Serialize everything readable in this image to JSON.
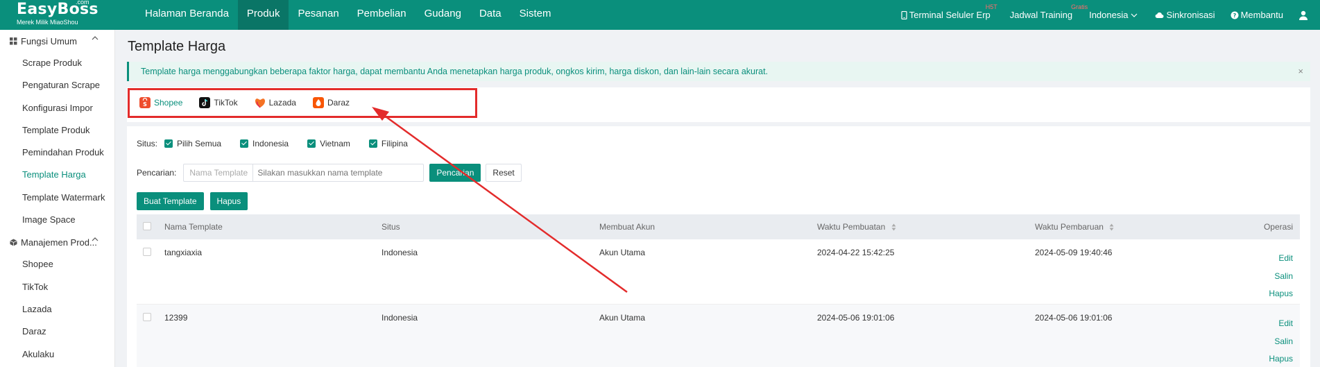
{
  "header": {
    "brand": "EasyBoss",
    "brand_suffix": ".com",
    "brand_sub": "Merek Milik MiaoShou",
    "nav": [
      "Halaman Beranda",
      "Produk",
      "Pesanan",
      "Pembelian",
      "Gudang",
      "Data",
      "Sistem"
    ],
    "active_nav": "Produk",
    "right": {
      "terminal": "Terminal Seluler Erp",
      "terminal_badge": "H5T",
      "training": "Jadwal Training",
      "training_badge": "Gratis",
      "language": "Indonesia",
      "sync": "Sinkronisasi",
      "help": "Membantu"
    }
  },
  "sidebar": {
    "group1": "Fungsi Umum",
    "group1_items": [
      "Scrape Produk",
      "Pengaturan Scrape",
      "Konfigurasi Impor",
      "Template Produk",
      "Pemindahan Produk",
      "Template Harga",
      "Template Watermark",
      "Image Space"
    ],
    "active_item": "Template Harga",
    "group2": "Manajemen Prod...",
    "group2_items": [
      "Shopee",
      "TikTok",
      "Lazada",
      "Daraz",
      "Akulaku"
    ]
  },
  "page": {
    "title": "Template Harga",
    "alert": "Template harga menggabungkan beberapa faktor harga, dapat membantu Anda menetapkan harga produk, ongkos kirim, harga diskon, dan lain-lain secara akurat.",
    "alert_close": "×",
    "platforms": [
      {
        "label": "Shopee",
        "color": "#ee4d2d",
        "active": true
      },
      {
        "label": "TikTok",
        "color": "#111111",
        "active": false
      },
      {
        "label": "Lazada",
        "color": "#f57224",
        "active": false
      },
      {
        "label": "Daraz",
        "color": "#f85606",
        "active": false
      }
    ],
    "filter": {
      "label": "Situs:",
      "options": [
        "Pilih Semua",
        "Indonesia",
        "Vietnam",
        "Filipina"
      ]
    },
    "search": {
      "label": "Pencarian:",
      "select_value": "Nama Template",
      "placeholder": "Silakan masukkan nama template",
      "search_btn": "Pencarian",
      "reset_btn": "Reset"
    },
    "actions": {
      "create": "Buat Template",
      "delete": "Hapus"
    },
    "table": {
      "columns": [
        "Nama Template",
        "Situs",
        "Membuat Akun",
        "Waktu Pembuatan",
        "Waktu Pembaruan",
        "Operasi"
      ],
      "rows": [
        {
          "name": "tangxiaxia",
          "site": "Indonesia",
          "account": "Akun Utama",
          "created": "2024-04-22 15:42:25",
          "updated": "2024-05-09 19:40:46",
          "ops": [
            "Edit",
            "Salin",
            "Hapus"
          ]
        },
        {
          "name": "12399",
          "site": "Indonesia",
          "account": "Akun Utama",
          "created": "2024-05-06 19:01:06",
          "updated": "2024-05-06 19:01:06",
          "ops": [
            "Edit",
            "Salin",
            "Hapus"
          ]
        }
      ]
    }
  },
  "colors": {
    "brand": "#0a8f7c",
    "annotation": "#e32b2b"
  }
}
